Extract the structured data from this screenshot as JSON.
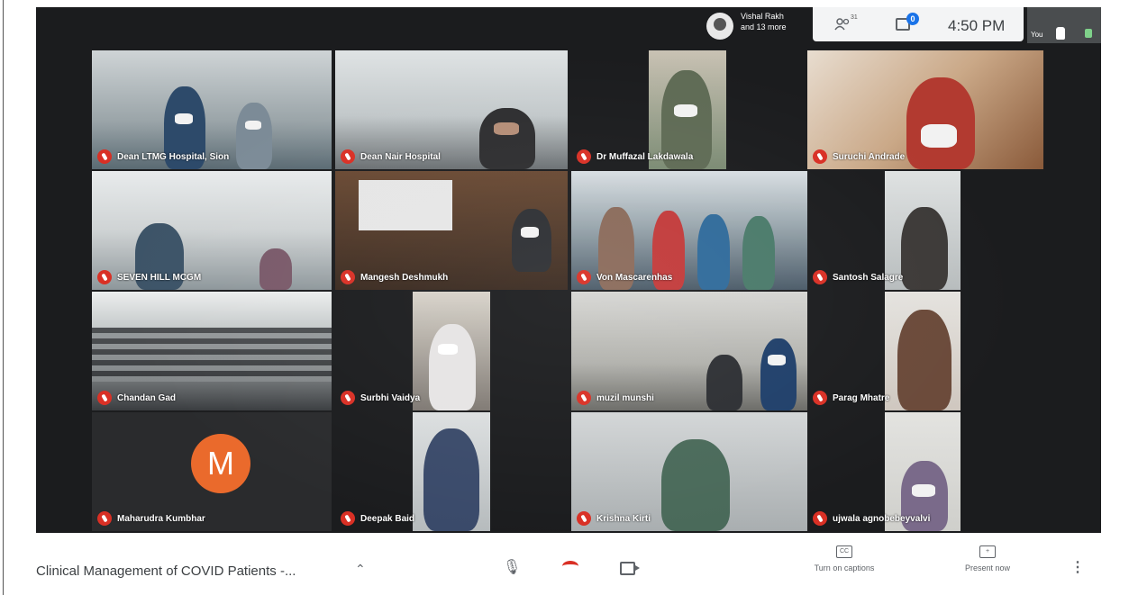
{
  "top_bar": {
    "speaker_line1": "Vishal Rakh",
    "speaker_line2": "and 13 more",
    "participant_count": "31",
    "chat_badge": "0",
    "clock": "4:50 PM",
    "self_label": "You"
  },
  "tiles": [
    {
      "name": "Dean LTMG Hospital, Sion"
    },
    {
      "name": "Dean Nair Hospital"
    },
    {
      "name": "Dr Muffazal Lakdawala"
    },
    {
      "name": "Suruchi Andrade"
    },
    {
      "name": "SEVEN HILL MCGM"
    },
    {
      "name": "Mangesh Deshmukh"
    },
    {
      "name": "Von Mascarenhas"
    },
    {
      "name": "Santosh Salagre"
    },
    {
      "name": "Chandan Gad"
    },
    {
      "name": "Surbhi Vaidya"
    },
    {
      "name": "muzil munshi"
    },
    {
      "name": "Parag Mhatre"
    },
    {
      "name": "Maharudra Kumbhar",
      "avatar_letter": "M"
    },
    {
      "name": "Deepak Baid"
    },
    {
      "name": "Krishna Kirti"
    },
    {
      "name": "ujwala agnobebeyvalvi"
    }
  ],
  "bottom_bar": {
    "meeting_title": "Clinical Management of COVID Patients -...",
    "captions_label": "Turn on captions",
    "present_label": "Present now",
    "captions_icon": "CC",
    "present_icon": "+"
  }
}
